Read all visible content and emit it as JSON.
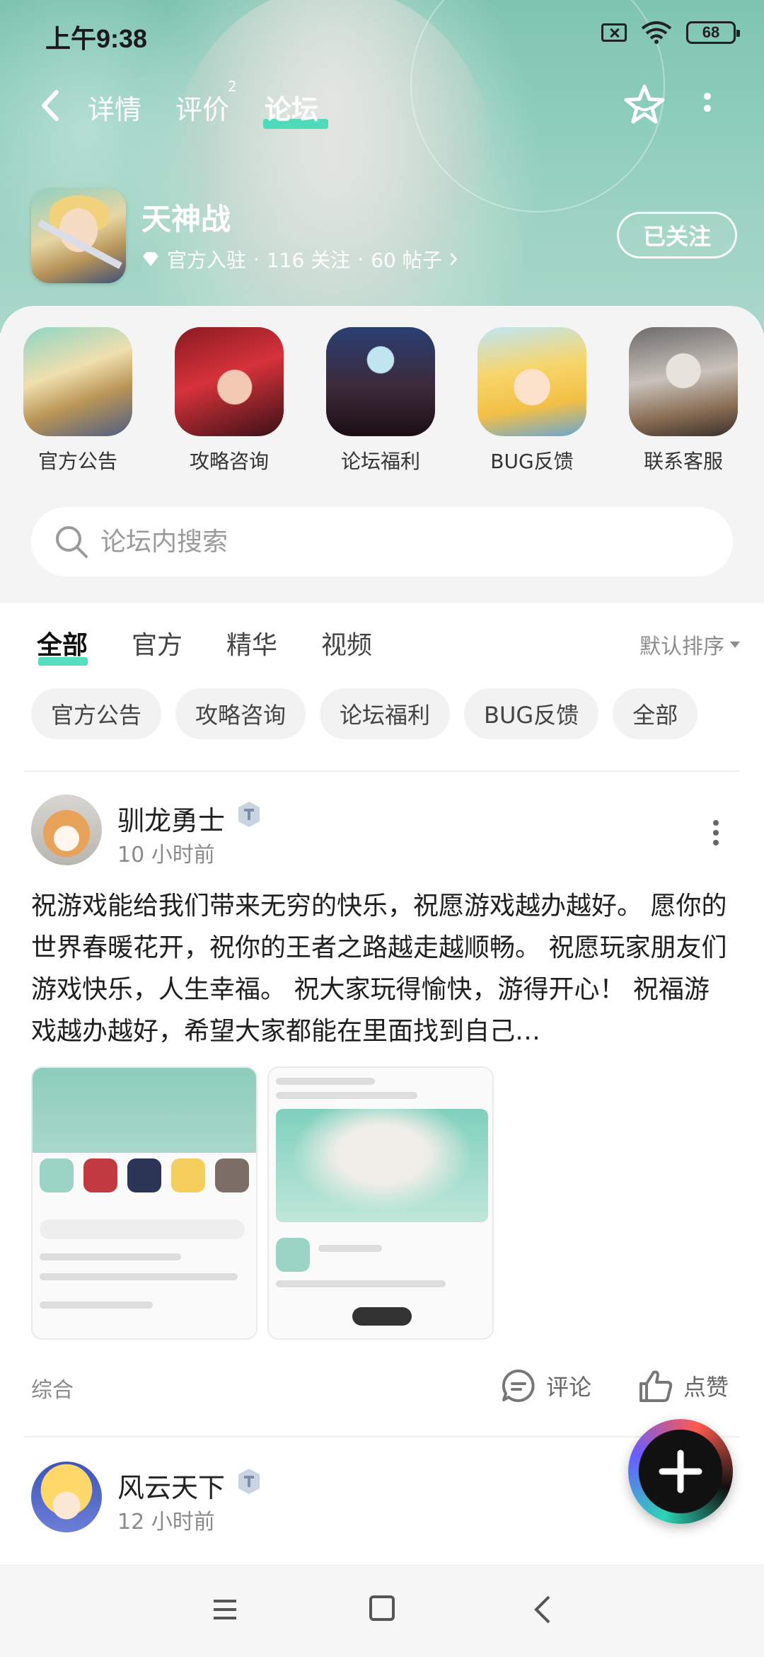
{
  "status_bar": {
    "time": "上午9:38",
    "battery": "68"
  },
  "nav": {
    "tabs": [
      {
        "label": "详情"
      },
      {
        "label": "评价",
        "badge": "2"
      },
      {
        "label": "论坛"
      }
    ],
    "active_tab": "论坛"
  },
  "game": {
    "title": "天神战",
    "official": "官方入驻",
    "followers": "116 关注",
    "posts": "60 帖子",
    "follow_button": "已关注"
  },
  "shortcuts": [
    {
      "label": "官方公告"
    },
    {
      "label": "攻略咨询"
    },
    {
      "label": "论坛福利"
    },
    {
      "label": "BUG反馈"
    },
    {
      "label": "联系客服"
    }
  ],
  "search": {
    "placeholder": "论坛内搜索"
  },
  "filter_tabs": [
    {
      "label": "全部"
    },
    {
      "label": "官方"
    },
    {
      "label": "精华"
    },
    {
      "label": "视频"
    }
  ],
  "sort_label": "默认排序",
  "chips": [
    "官方公告",
    "攻略咨询",
    "论坛福利",
    "BUG反馈",
    "全部"
  ],
  "posts": [
    {
      "username": "驯龙勇士",
      "time": "10 小时前",
      "text": "祝游戏能给我们带来无穷的快乐，祝愿游戏越办越好。 愿你的世界春暖花开，祝你的王者之路越走越顺畅。 祝愿玩家朋友们游戏快乐，人生幸福。 祝大家玩得愉快，游得开心！ 祝福游戏越办越好，希望大家都能在里面找到自己…",
      "category": "综合",
      "comment_label": "评论",
      "like_label": "点赞"
    },
    {
      "username": "风云天下",
      "time": "12 小时前"
    }
  ],
  "colors": {
    "accent": "#35d9b3",
    "header_bg": "#8ccdbb"
  }
}
